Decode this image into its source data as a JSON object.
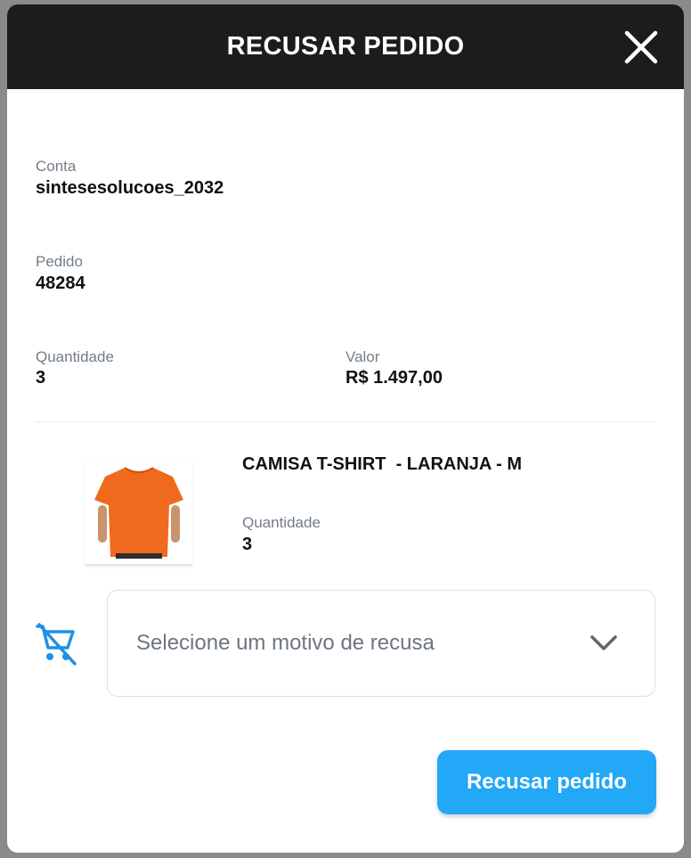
{
  "modal": {
    "title": "RECUSAR PEDIDO",
    "close_icon": "close-icon"
  },
  "fields": {
    "conta": {
      "label": "Conta",
      "value": "sintesesolucoes_2032"
    },
    "pedido": {
      "label": "Pedido",
      "value": "48284"
    },
    "quantidade": {
      "label": "Quantidade",
      "value": "3"
    },
    "valor": {
      "label": "Valor",
      "value": "R$ 1.497,00"
    }
  },
  "product": {
    "name": "CAMISA T-SHIRT  - LARANJA - M",
    "quantity_label": "Quantidade",
    "quantity_value": "3",
    "image": "orange-tshirt",
    "color": "#f06a1d"
  },
  "reason_select": {
    "icon": "remove-cart-icon",
    "placeholder": "Selecione um motivo de recusa"
  },
  "submit": {
    "label": "Recusar pedido",
    "color": "#23a7f7"
  },
  "colors": {
    "header": "#1b1c1e",
    "accent": "#23a7f7",
    "label": "#737d88"
  }
}
